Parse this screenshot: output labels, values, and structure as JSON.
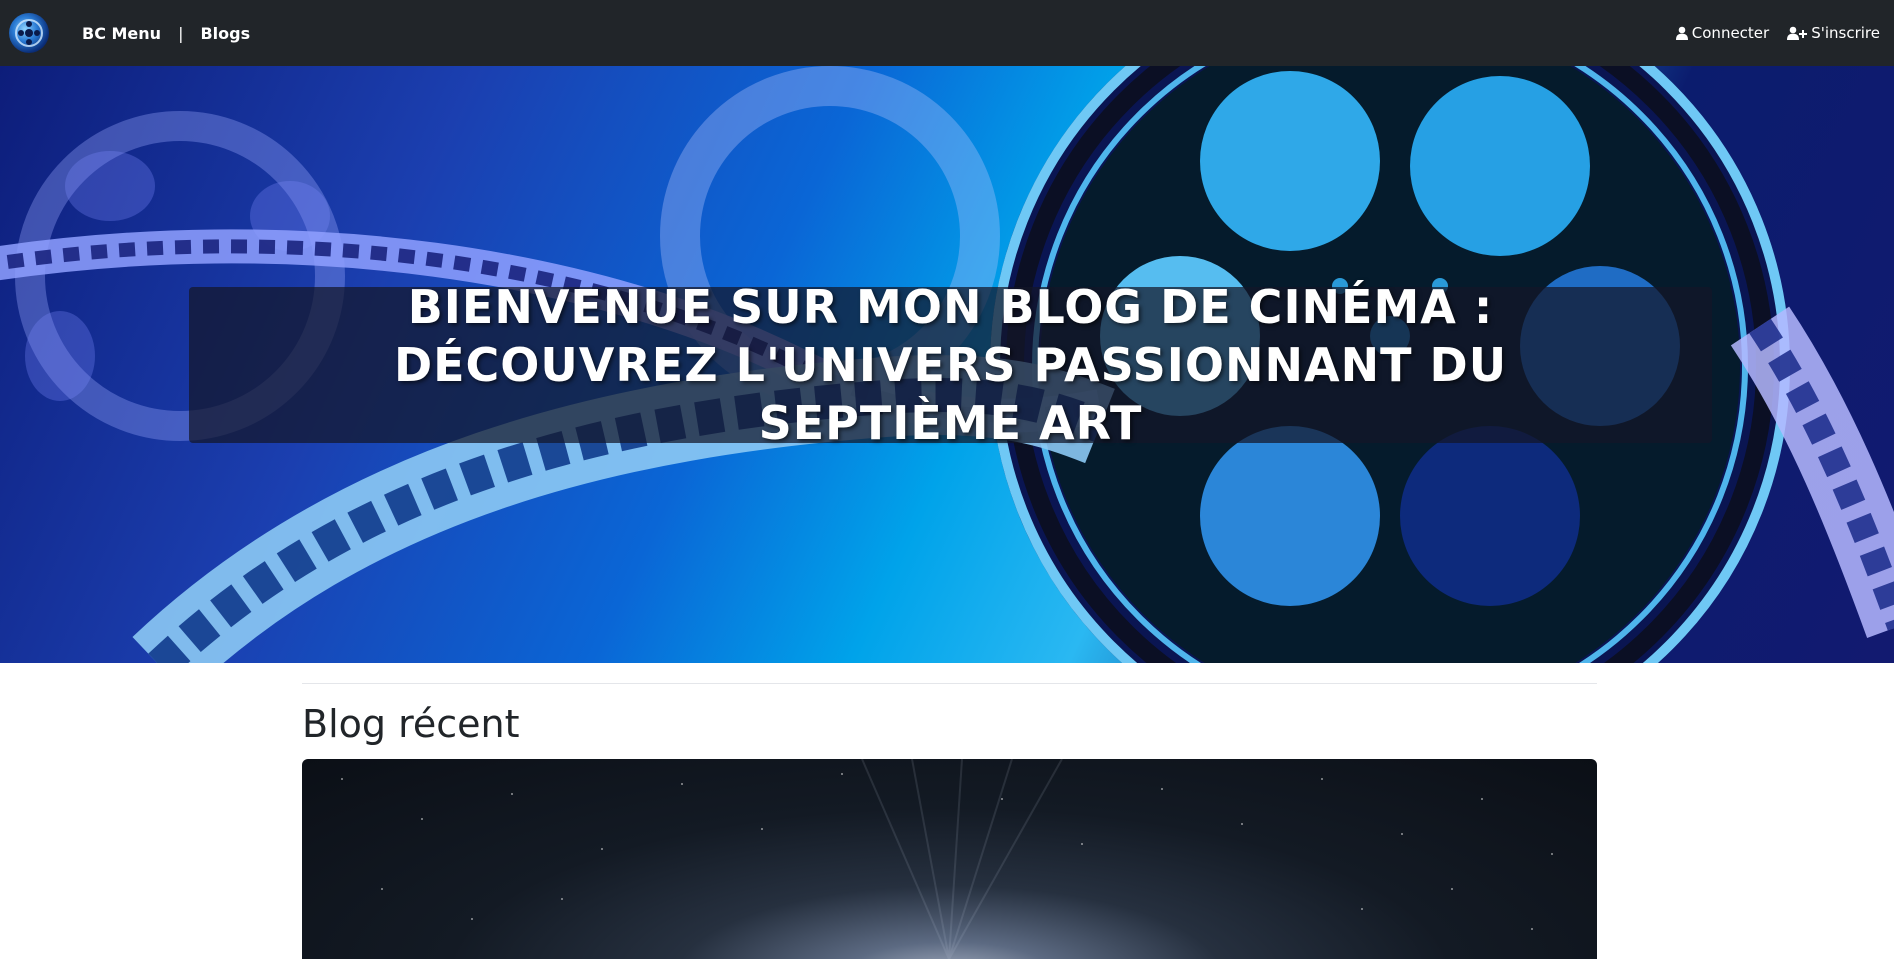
{
  "navbar": {
    "brand": "BC Menu",
    "separator": "|",
    "blogs_link": "Blogs",
    "login_label": "Connecter",
    "login_icon": "user-icon",
    "register_label": "S'inscrire",
    "register_icon": "user-plus-icon",
    "background": "#212529"
  },
  "hero": {
    "title": "Bienvenue sur mon blog de cinéma : Découvrez l'univers passionnant du septième art"
  },
  "main": {
    "section_title": "Blog récent"
  }
}
